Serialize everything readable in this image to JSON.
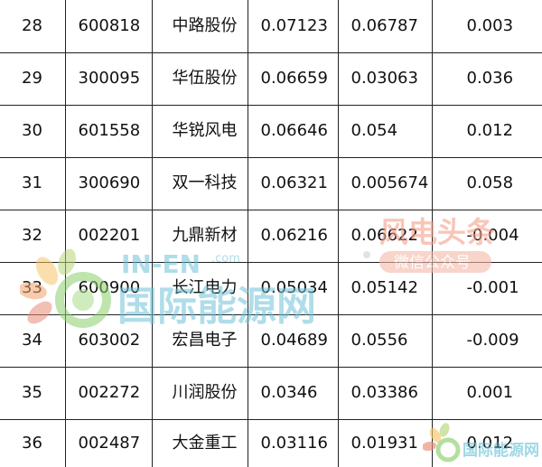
{
  "table": {
    "rows": [
      {
        "rank": "28",
        "code": "600818",
        "name": "中路股份",
        "v1": "0.07123",
        "v2": "0.06787",
        "v3": "0.003"
      },
      {
        "rank": "29",
        "code": "300095",
        "name": "华伍股份",
        "v1": "0.06659",
        "v2": "0.03063",
        "v3": "0.036"
      },
      {
        "rank": "30",
        "code": "601558",
        "name": "华锐风电",
        "v1": "0.06646",
        "v2": "0.054",
        "v3": "0.012"
      },
      {
        "rank": "31",
        "code": "300690",
        "name": "双一科技",
        "v1": "0.06321",
        "v2": "0.005674",
        "v3": "0.058"
      },
      {
        "rank": "32",
        "code": "002201",
        "name": "九鼎新材",
        "v1": "0.06216",
        "v2": "0.06622",
        "v3": "-0.004"
      },
      {
        "rank": "33",
        "code": "600900",
        "name": "长江电力",
        "v1": "0.05034",
        "v2": "0.05142",
        "v3": "-0.001"
      },
      {
        "rank": "34",
        "code": "603002",
        "name": "宏昌电子",
        "v1": "0.04689",
        "v2": "0.0556",
        "v3": "-0.009"
      },
      {
        "rank": "35",
        "code": "002272",
        "name": "川润股份",
        "v1": "0.0346",
        "v2": "0.03386",
        "v3": "0.001"
      },
      {
        "rank": "36",
        "code": "002487",
        "name": "大金重工",
        "v1": "0.03116",
        "v2": "0.01931",
        "v3": "0.012"
      }
    ]
  },
  "watermarks": {
    "inen": {
      "latin": "IN-EN",
      "suffix": ".com",
      "chinese": "国际能源网",
      "color": "#6ec2d8"
    },
    "fengdian": {
      "title": "风电头条",
      "subtitle": "微信公众号",
      "color": "#f4a08a"
    },
    "bottom": {
      "chinese": "国际能源网",
      "color": "#6ec2d8"
    }
  },
  "colors": {
    "text": "#111111",
    "grid": "#222222",
    "background": "#ffffff"
  }
}
